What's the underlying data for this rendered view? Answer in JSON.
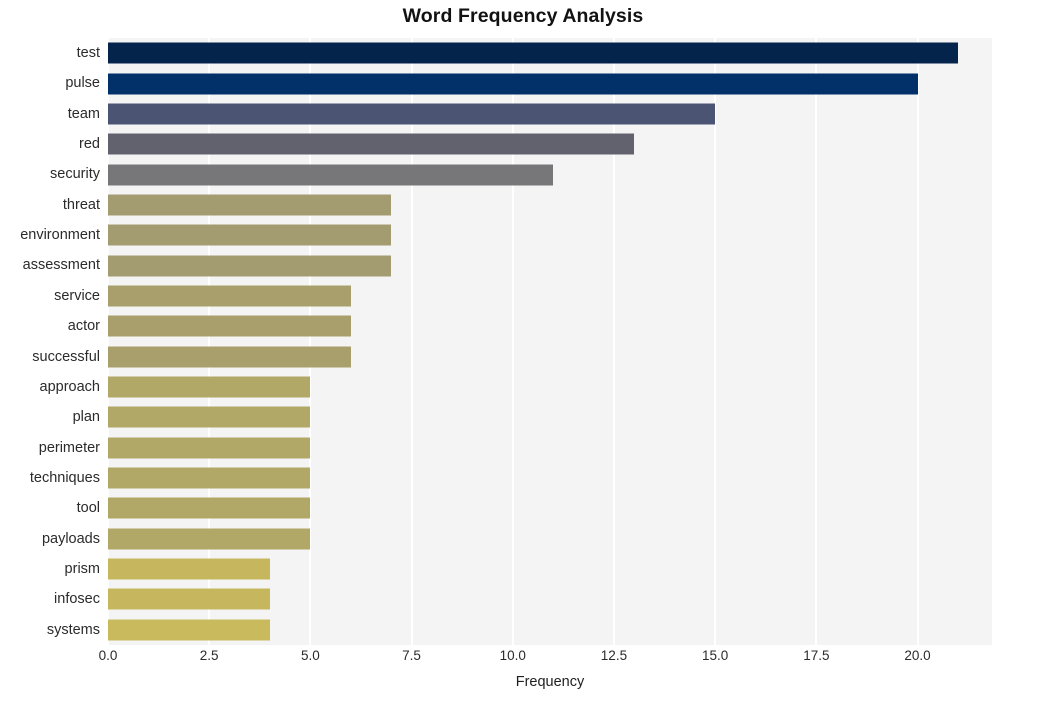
{
  "chart_data": {
    "type": "bar",
    "orientation": "horizontal",
    "title": "Word Frequency Analysis",
    "xlabel": "Frequency",
    "ylabel": "",
    "xlim": [
      0,
      21.84
    ],
    "xticks": [
      "0.0",
      "2.5",
      "5.0",
      "7.5",
      "10.0",
      "12.5",
      "15.0",
      "17.5",
      "20.0"
    ],
    "xtick_values": [
      0,
      2.5,
      5,
      7.5,
      10,
      12.5,
      15,
      17.5,
      20
    ],
    "grid": true,
    "legend": false,
    "categories": [
      "test",
      "pulse",
      "team",
      "red",
      "security",
      "threat",
      "environment",
      "assessment",
      "service",
      "actor",
      "successful",
      "approach",
      "plan",
      "perimeter",
      "techniques",
      "tool",
      "payloads",
      "prism",
      "infosec",
      "systems"
    ],
    "values": [
      21,
      20,
      15,
      13,
      11,
      7,
      7,
      7,
      6,
      6,
      6,
      5,
      5,
      5,
      5,
      5,
      5,
      4,
      4,
      4
    ],
    "bar_colors": [
      "#04244c",
      "#023169",
      "#4b5472",
      "#62626f",
      "#77777a",
      "#a39c71",
      "#a39c71",
      "#a39c71",
      "#a89f6c",
      "#a89f6c",
      "#a89f6c",
      "#b1a767",
      "#b1a767",
      "#b1a767",
      "#b1a767",
      "#b1a767",
      "#b1a767",
      "#c6b75f",
      "#c6b75f",
      "#c8ba5d"
    ],
    "plot_background": "#f4f4f5",
    "grid_color": "#ffffff",
    "figure_background": "#ffffff"
  }
}
